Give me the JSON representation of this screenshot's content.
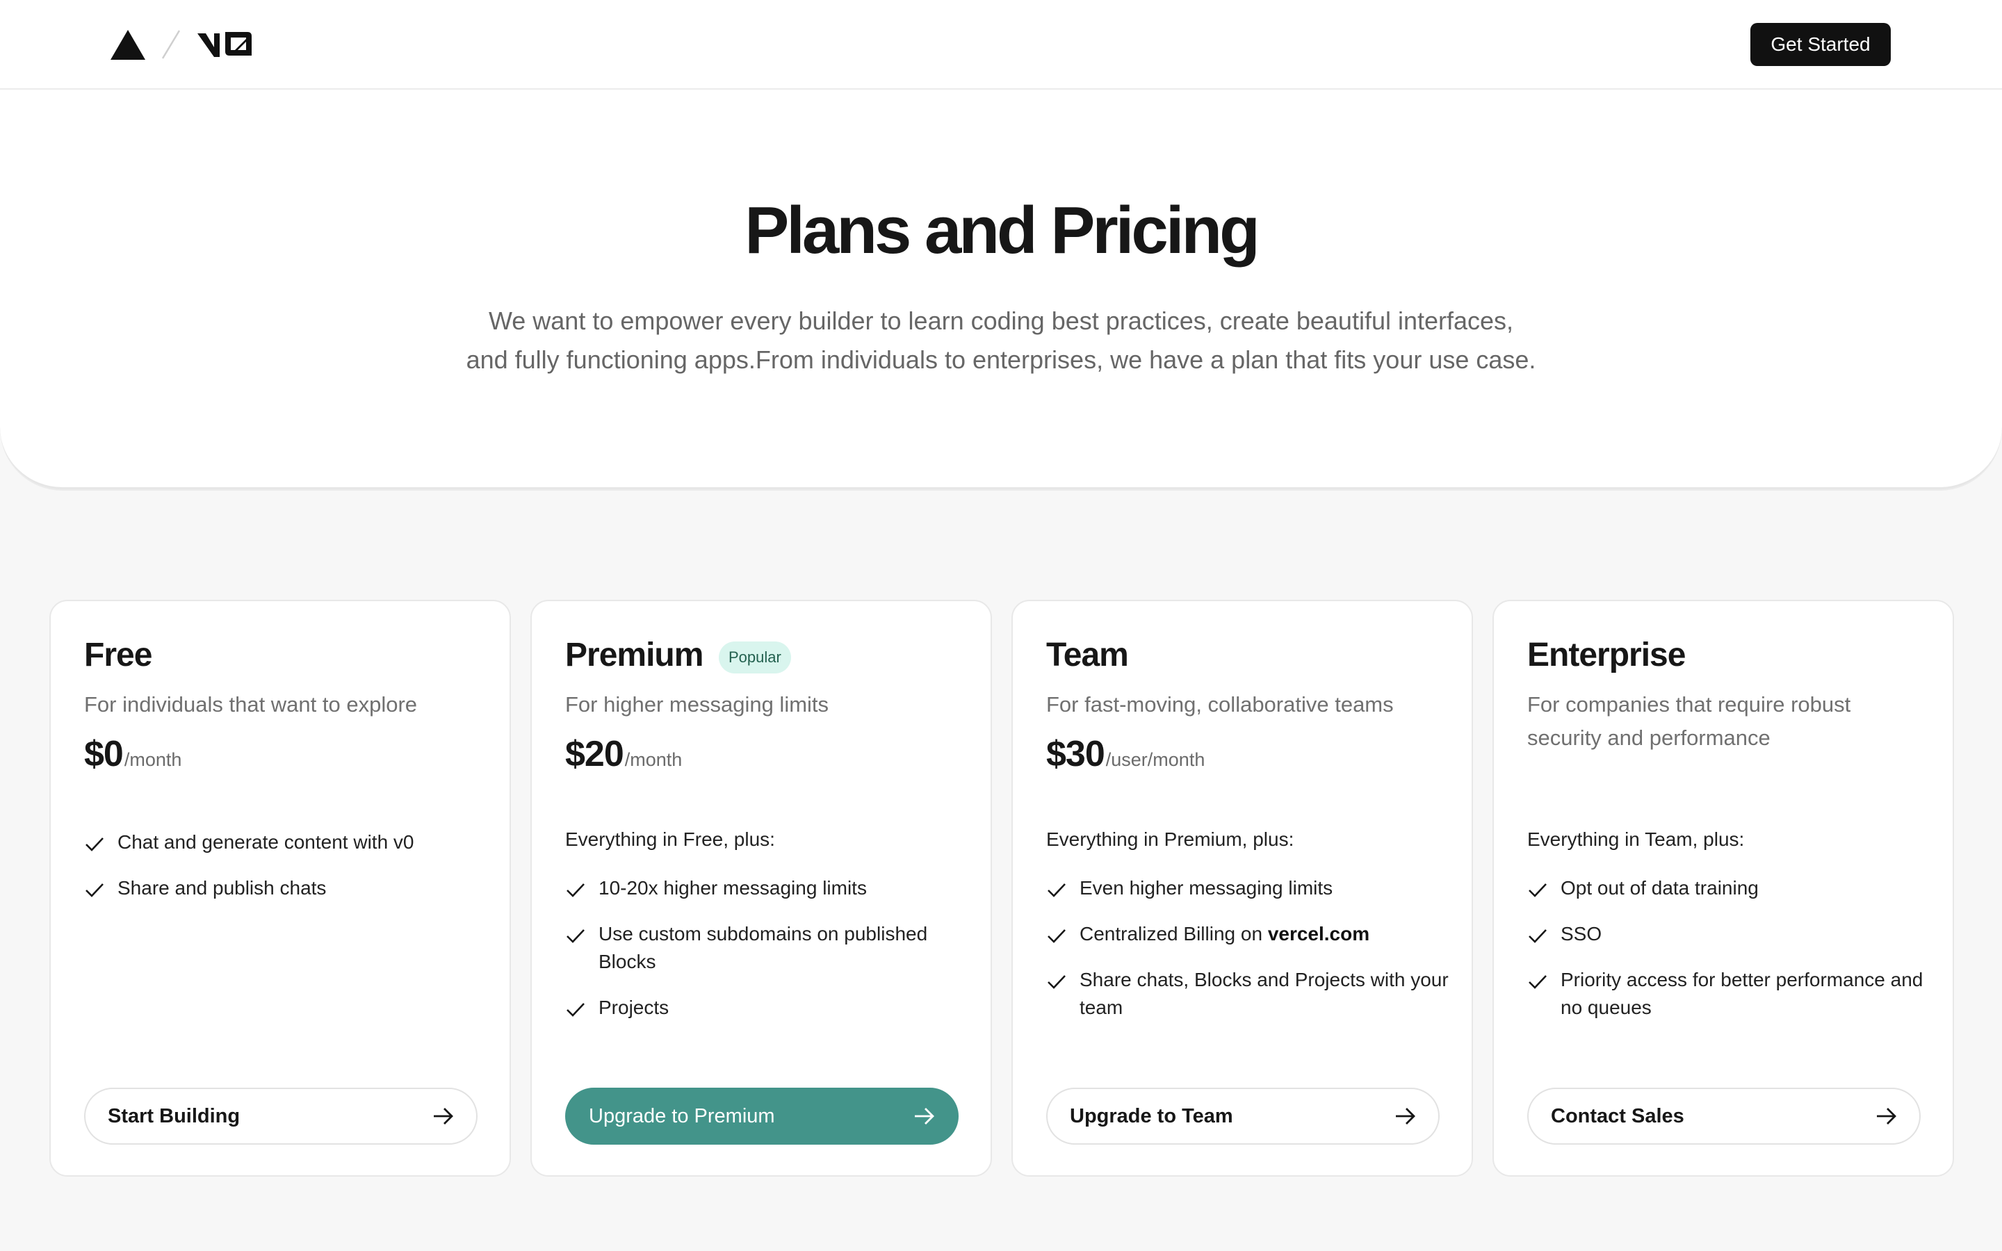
{
  "header": {
    "get_started_label": "Get Started"
  },
  "hero": {
    "title": "Plans and Pricing",
    "subtitle_line1": "We want to empower every builder to learn coding best practices, create beautiful interfaces,",
    "subtitle_line2": "and fully functioning apps.From individuals to enterprises, we have a plan that fits your use case."
  },
  "plans": [
    {
      "name": "Free",
      "description": "For individuals that want to explore",
      "price": "$0",
      "unit": "/month",
      "includes": "",
      "features": [
        "Chat and generate content with v0",
        "Share and publish chats"
      ],
      "cta": "Start Building"
    },
    {
      "name": "Premium",
      "badge": "Popular",
      "description": "For higher messaging limits",
      "price": "$20",
      "unit": "/month",
      "includes": "Everything in Free, plus:",
      "features": [
        "10-20x higher messaging limits",
        "Use custom subdomains on published Blocks",
        "Projects"
      ],
      "cta": "Upgrade to Premium"
    },
    {
      "name": "Team",
      "description": "For fast-moving, collaborative teams",
      "price": "$30",
      "unit": "/user/month",
      "includes": "Everything in Premium, plus:",
      "features": [
        "Even higher messaging limits",
        "Centralized Billing on ",
        "Share chats, Blocks and Projects with your team"
      ],
      "feature_link": "vercel.com",
      "cta": "Upgrade to Team"
    },
    {
      "name": "Enterprise",
      "description": "For companies that require robust security and performance",
      "price": "",
      "unit": "",
      "includes": "Everything in Team, plus:",
      "features": [
        "Opt out of data training",
        "SSO",
        "Priority access for better performance and no queues"
      ],
      "cta": "Contact Sales"
    }
  ],
  "colors": {
    "primary_button": "#43948a",
    "badge_bg": "#d9f5ee",
    "badge_text": "#23614f",
    "dark_button": "#111111"
  },
  "icons": [
    "vercel-triangle-icon",
    "divider-slash-icon",
    "v0-logo-icon",
    "check-icon",
    "arrow-right-icon"
  ]
}
